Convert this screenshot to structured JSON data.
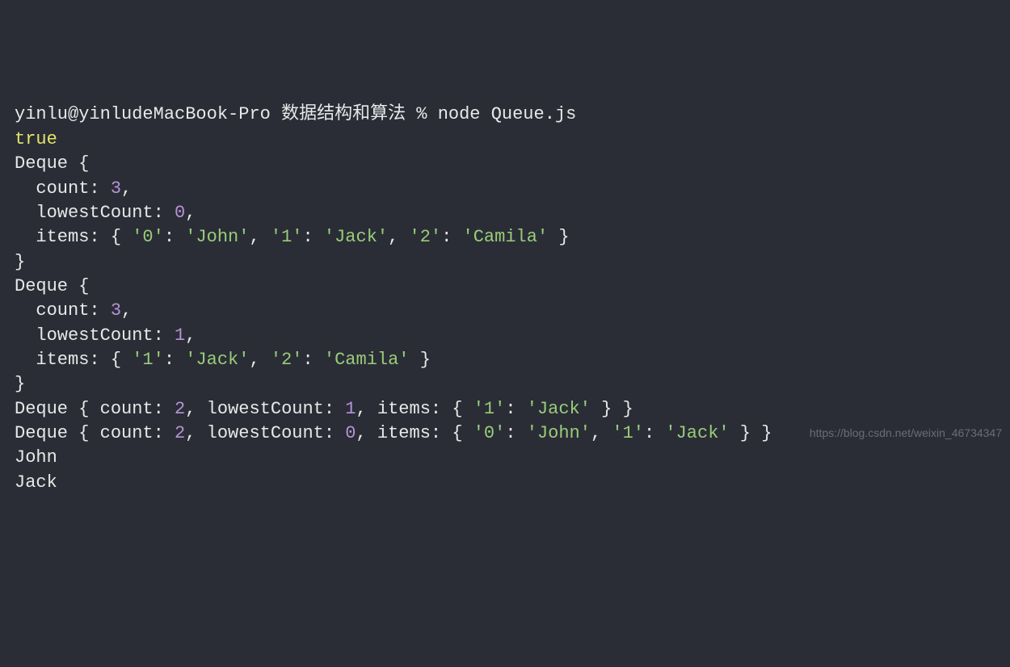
{
  "prompt": {
    "user_host": "yinlu@yinludeMacBook-Pro",
    "dir": "数据结构和算法",
    "separator": "%",
    "command": "node Queue.js"
  },
  "line_true": "true",
  "deque1": {
    "open": "Deque {",
    "count_label": "  count: ",
    "count_val": "3",
    "comma": ",",
    "lowest_label": "  lowestCount: ",
    "lowest_val": "0",
    "items_label": "  items: { ",
    "k0": "'0'",
    "c0": ": ",
    "v0": "'John'",
    "k1": "'1'",
    "c1": ": ",
    "v1": "'Jack'",
    "k2": "'2'",
    "c2": ": ",
    "v2": "'Camila'",
    "items_close": " }",
    "close": "}"
  },
  "deque2": {
    "open": "Deque {",
    "count_label": "  count: ",
    "count_val": "3",
    "comma": ",",
    "lowest_label": "  lowestCount: ",
    "lowest_val": "1",
    "items_label": "  items: { ",
    "k1": "'1'",
    "c1": ": ",
    "v1": "'Jack'",
    "k2": "'2'",
    "c2": ": ",
    "v2": "'Camila'",
    "items_close": " }",
    "close": "}"
  },
  "deque3": {
    "prefix": "Deque { count: ",
    "count_val": "2",
    "mid1": ", lowestCount: ",
    "lowest_val": "1",
    "mid2": ", items: { ",
    "k1": "'1'",
    "c1": ": ",
    "v1": "'Jack'",
    "close": " } }"
  },
  "deque4": {
    "prefix": "Deque { count: ",
    "count_val": "2",
    "mid1": ", lowestCount: ",
    "lowest_val": "0",
    "mid2": ", items: { ",
    "k0": "'0'",
    "c0": ": ",
    "v0": "'John'",
    "k1": "'1'",
    "c1": ": ",
    "v1": "'Jack'",
    "sep": ", ",
    "close": " } }"
  },
  "john": "John",
  "jack": "Jack",
  "watermark": "https://blog.csdn.net/weixin_46734347"
}
